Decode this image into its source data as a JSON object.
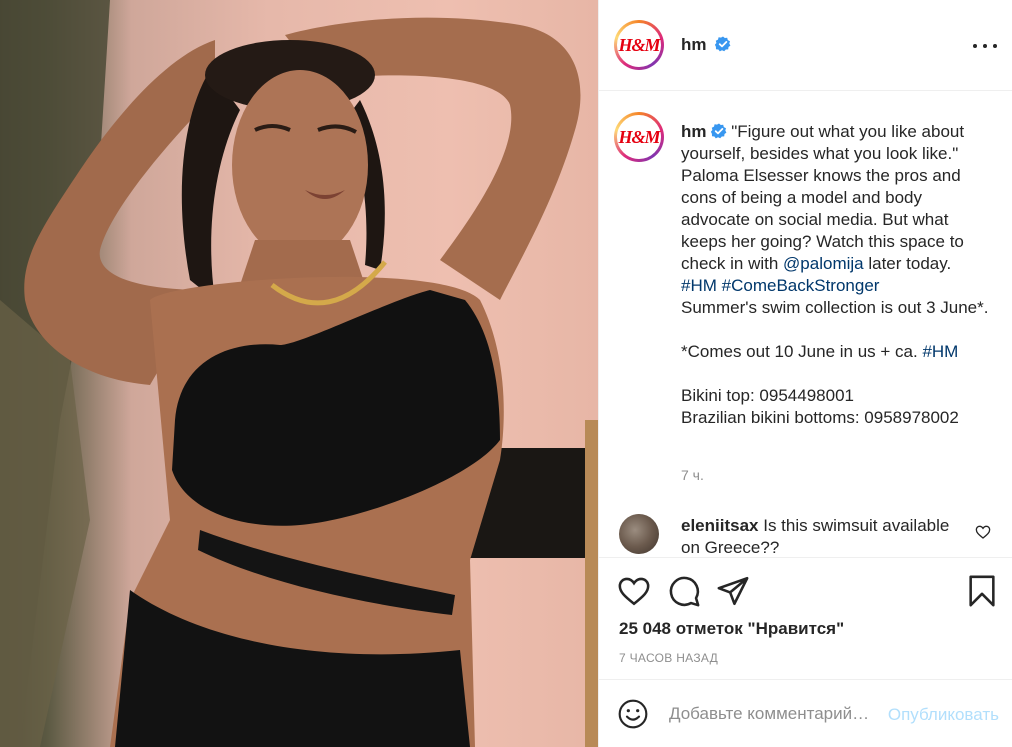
{
  "header": {
    "avatar_text": "H&M",
    "username": "hm",
    "verified_icon": "verified-badge-icon",
    "more_icon": "more-options-icon"
  },
  "caption": {
    "username": "hm",
    "text": "\"Figure out what you like about yourself, besides what you look like.\" Paloma Elsesser knows the pros and cons of being a model and body advocate on social media. But what keeps her going? Watch this space to check in with ",
    "mention": "@palomija",
    "after_mention": " later today.",
    "hashtag1": "#HM",
    "hashtag2": "#ComeBackStronger",
    "line_swim": "Summer's swim collection is out 3 June*.",
    "line_comes": "*Comes out 10 June in us + ca. ",
    "hashtag3": "#HM",
    "line_top": "Bikini top: 0954498001",
    "line_bottoms": "Brazilian bikini bottoms: 0958978002",
    "time": "7 ч."
  },
  "comment": {
    "username": "eleniitsax",
    "text": "Is this swimsuit available on Greece??",
    "like_icon": "heart-outline-icon"
  },
  "actions": {
    "icons": [
      "heart-icon",
      "comment-icon",
      "share-icon",
      "bookmark-icon"
    ],
    "likes": "25 048 отметок \"Нравится\"",
    "ago": "7 ЧАСОВ НАЗАД"
  },
  "add_comment": {
    "emoji_icon": "emoji-icon",
    "placeholder": "Добавьте комментарий…",
    "publish_label": "Опубликовать",
    "publish_color": "#b2dffc"
  },
  "colors": {
    "link": "#00376b",
    "muted": "#8e8e8e",
    "brand_red": "#e50010"
  }
}
